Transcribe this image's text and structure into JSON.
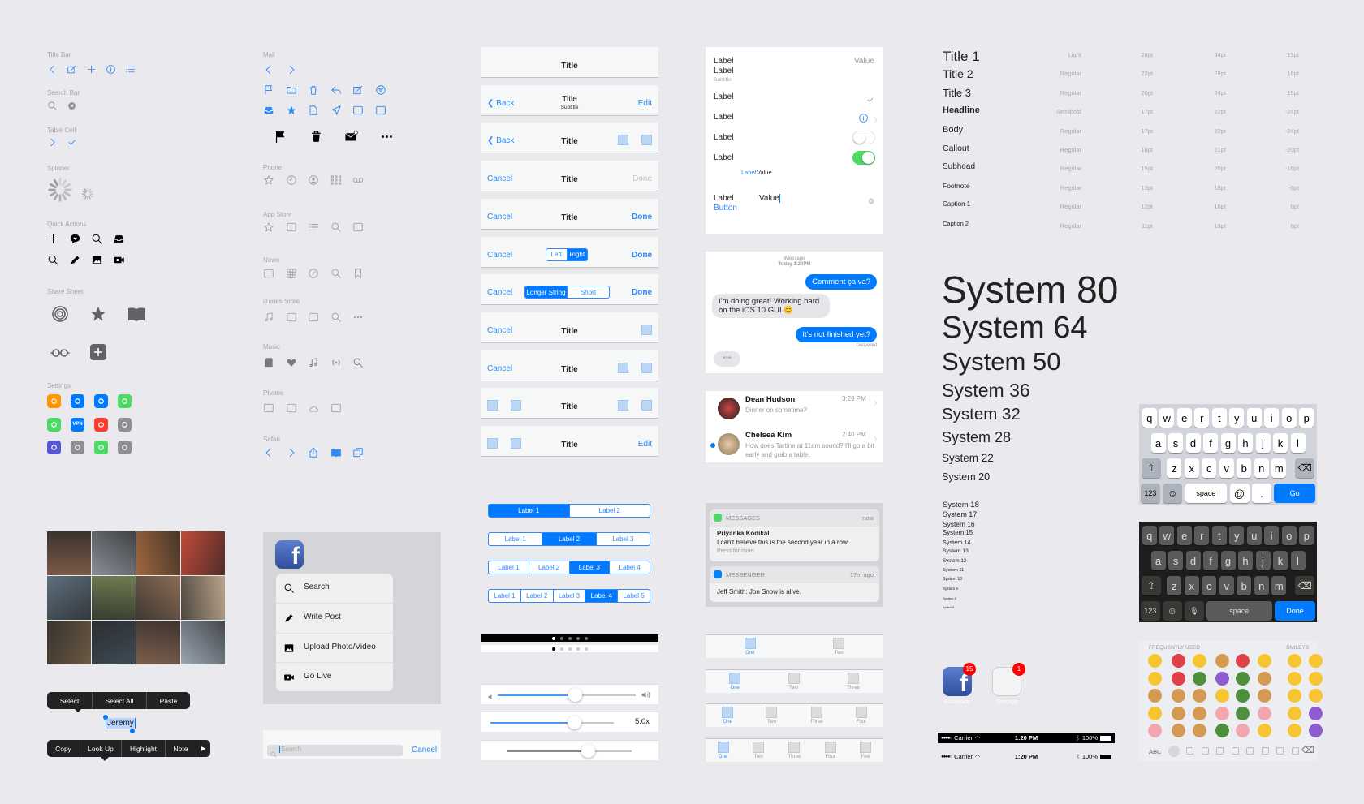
{
  "colors": {
    "accent": "#007aff",
    "green": "#4cd964",
    "background": "#e9e9ee",
    "badge": "#ff0000"
  },
  "left_sections": [
    {
      "label": "Title Bar",
      "color": "#2e88f6",
      "rows": [
        [
          "chevron-left-icon",
          "compose-icon",
          "plus-icon",
          "info-icon",
          "list-icon"
        ]
      ]
    },
    {
      "label": "Search Bar",
      "color": "#8e8e93",
      "rows": [
        [
          "search-icon",
          "clear-icon"
        ]
      ]
    },
    {
      "label": "Table Cell",
      "color": "#2e88f6",
      "rows": [
        [
          "chevron-right-icon",
          "checkmark-icon"
        ]
      ]
    },
    {
      "label": "Spinner",
      "color": "#8e8e93",
      "rows": []
    },
    {
      "label": "Quick Actions",
      "color": "#000000",
      "rows": [
        [
          "plus-icon",
          "message-heart-icon",
          "search-icon",
          "inbox-icon"
        ],
        [
          "search-icon",
          "pencil-icon",
          "photo-icon",
          "video-icon"
        ]
      ]
    },
    {
      "label": "Share Sheet",
      "color": "#636366",
      "rows": [
        [
          "airdrop-icon",
          "star-filled-icon",
          "book-icon"
        ],
        [
          "glasses-icon",
          "add-square-icon"
        ]
      ]
    },
    {
      "label": "Settings",
      "color": "",
      "rows": []
    }
  ],
  "settings_icons": [
    [
      {
        "icon": "airplane-icon",
        "color": "#ff9500"
      },
      {
        "icon": "wifi-icon",
        "color": "#007aff"
      },
      {
        "icon": "bluetooth-icon",
        "color": "#007aff"
      },
      {
        "icon": "cellular-icon",
        "color": "#4cd964"
      }
    ],
    [
      {
        "icon": "hotspot-icon",
        "color": "#4cd964"
      },
      {
        "icon": "vpn-icon",
        "color": "#007aff",
        "text": "VPN"
      },
      {
        "icon": "notifications-icon",
        "color": "#ff3b30"
      },
      {
        "icon": "control-center-icon",
        "color": "#8e8e93"
      }
    ],
    [
      {
        "icon": "do-not-disturb-icon",
        "color": "#5856d6"
      },
      {
        "icon": "general-icon",
        "color": "#8e8e93"
      },
      {
        "icon": "battery-icon",
        "color": "#4cd964"
      },
      {
        "icon": "privacy-icon",
        "color": "#8e8e93"
      }
    ]
  ],
  "mid_sections": [
    {
      "label": "Mail",
      "color": "#2e88f6",
      "rows": [
        [
          "chevron-left-icon",
          "chevron-right-icon"
        ],
        [
          "flag-icon",
          "folder-icon",
          "trash-icon",
          "reply-icon",
          "compose-icon",
          "filter-icon"
        ],
        [
          "inbox-icon",
          "star-filled-icon",
          "document-icon",
          "send-icon",
          "archive-x-icon",
          "archive-icon"
        ]
      ],
      "black_row": [
        "flag-filled-icon",
        "trash-filled-icon",
        "mail-unread-icon",
        "more-icon"
      ]
    },
    {
      "label": "Phone",
      "color": "#a0a0a6",
      "rows": [
        [
          "star-icon",
          "clock-icon",
          "contact-icon",
          "keypad-icon",
          "voicemail-icon"
        ]
      ]
    },
    {
      "label": "App Store",
      "color": "#a0a0a6",
      "rows": [
        [
          "star-icon",
          "stack-icon",
          "list-icon",
          "search-icon",
          "download-icon"
        ]
      ]
    },
    {
      "label": "News",
      "color": "#a0a0a6",
      "rows": [
        [
          "newspaper-icon",
          "grid-icon",
          "compass-icon",
          "search-icon",
          "bookmark-icon"
        ]
      ]
    },
    {
      "label": "iTunes Store",
      "color": "#a0a0a6",
      "rows": [
        [
          "music-note-icon",
          "film-icon",
          "tv-icon",
          "search-icon",
          "more-icon"
        ]
      ]
    },
    {
      "label": "Music",
      "color": "#7a7a80",
      "rows": [
        [
          "library-icon",
          "heart-icon",
          "music-note-icon",
          "radio-icon",
          "search-icon"
        ]
      ]
    },
    {
      "label": "Photos",
      "color": "#a0a0a6",
      "rows": [
        [
          "albums-icon",
          "memories-icon",
          "cloud-icon",
          "stack-icon"
        ]
      ]
    },
    {
      "label": "Safari",
      "color": "#2e88f6",
      "rows": [
        [
          "chevron-left-icon",
          "chevron-right-icon",
          "share-icon",
          "book-icon",
          "tabs-icon"
        ]
      ]
    }
  ],
  "edit_menu": {
    "top": [
      "Select",
      "Select All",
      "Paste"
    ],
    "selected_text": "Jeremy",
    "bottom": [
      "Copy",
      "Look Up",
      "Highlight",
      "Note"
    ]
  },
  "quick_action_menu": {
    "app": "facebook-icon",
    "items": [
      {
        "icon": "search-icon",
        "label": "Search"
      },
      {
        "icon": "pencil-icon",
        "label": "Write Post"
      },
      {
        "icon": "photo-icon",
        "label": "Upload Photo/Video"
      },
      {
        "icon": "video-icon",
        "label": "Go Live"
      }
    ]
  },
  "search_bar": {
    "placeholder": "Search",
    "cancel": "Cancel"
  },
  "nav_bars": [
    {
      "left": "",
      "title": "Title",
      "right": ""
    },
    {
      "left": "Back",
      "back": true,
      "title": "Title",
      "subtitle": "Subtitle",
      "right": "Edit"
    },
    {
      "left": "Back",
      "back": true,
      "title": "Title",
      "right_squares": 2
    },
    {
      "left": "Cancel",
      "title": "Title",
      "right": "Done",
      "right_disabled": true
    },
    {
      "left": "Cancel",
      "title": "Title",
      "right": "Done",
      "right_bold": true
    },
    {
      "left": "Cancel",
      "segment": [
        "Left",
        "Right"
      ],
      "segment_selected": 1,
      "right": "Done",
      "right_bold": true
    },
    {
      "left": "Cancel",
      "segment": [
        "Longer String",
        "Short"
      ],
      "segment_selected": 0,
      "right": "Done",
      "right_bold": true
    },
    {
      "left": "Cancel",
      "title": "Title",
      "right_squares": 1
    },
    {
      "left": "Cancel",
      "title": "Title",
      "right_squares": 2
    },
    {
      "left_squares": 2,
      "title": "Title",
      "right_squares": 2
    },
    {
      "left_squares": 2,
      "title": "Title",
      "right": "Edit"
    }
  ],
  "segmented_controls": [
    {
      "labels": [
        "Label 1",
        "Label 2"
      ],
      "selected": 0
    },
    {
      "labels": [
        "Label 1",
        "Label 2",
        "Label 3"
      ],
      "selected": 1
    },
    {
      "labels": [
        "Label 1",
        "Label 2",
        "Label 3",
        "Label 4"
      ],
      "selected": 2
    },
    {
      "labels": [
        "Label 1",
        "Label 2",
        "Label 3",
        "Label 4",
        "Label 5"
      ],
      "selected": 3
    }
  ],
  "page_controls": {
    "count": 5,
    "current": 0
  },
  "sliders": [
    {
      "value": 0.56,
      "min_icon": "volume-low-icon",
      "max_icon": "volume-high-icon"
    },
    {
      "value": 0.68,
      "label": "5.0x"
    },
    {
      "value": 0.65
    }
  ],
  "table": {
    "rows": [
      {
        "label": "Label",
        "value": "Value"
      },
      {
        "label": "Label",
        "subtitle": "Subtitle"
      },
      {
        "label": "Label",
        "accessory": "checkmark"
      },
      {
        "label": "Label",
        "accessory": "info-disclosure"
      },
      {
        "label": "Label",
        "toggle": false
      },
      {
        "label": "Label",
        "toggle": true
      },
      {
        "inline_label": "Label",
        "inline_value": "Value"
      },
      {
        "label": "Label",
        "field_value": "Value"
      }
    ],
    "button": "Button"
  },
  "imessage": {
    "service": "iMessage",
    "time": "Today 1:20PM",
    "messages": [
      {
        "from": "me",
        "text": "Comment ça va?"
      },
      {
        "from": "them",
        "text": "I'm doing great! Working hard on the iOS 10 GUI 😊"
      },
      {
        "from": "me",
        "text": "It's not finished yet?"
      }
    ],
    "status": "Delivered"
  },
  "conversations": [
    {
      "name": "Dean Hudson",
      "time": "3:29 PM",
      "preview": "Dinner on sometime?",
      "unread": false
    },
    {
      "name": "Chelsea Kim",
      "time": "2:40 PM",
      "preview": "How does Tartine at 11am sound? I'll go a bit early and grab a table.",
      "unread": true
    }
  ],
  "notifications": [
    {
      "app": "MESSAGES",
      "time": "now",
      "title": "Priyanka Kodikal",
      "body": "I can't believe this is the second year in a row.",
      "hint": "Press for more",
      "color": "#4cd964"
    },
    {
      "app": "MESSENGER",
      "time": "17m ago",
      "body": "Jeff Smith: Jon Snow is alive.",
      "color": "#0084ff"
    }
  ],
  "tab_bars": [
    [
      "One",
      "Two"
    ],
    [
      "One",
      "Two",
      "Three"
    ],
    [
      "One",
      "Two",
      "Three",
      "Four"
    ],
    [
      "One",
      "Two",
      "Three",
      "Four",
      "Five"
    ]
  ],
  "typography": [
    {
      "name": "Title 1",
      "weight": "Light",
      "size": "28pt",
      "leading": "34pt",
      "tracking": "13pt"
    },
    {
      "name": "Title 2",
      "weight": "Regular",
      "size": "22pt",
      "leading": "28pt",
      "tracking": "16pt"
    },
    {
      "name": "Title 3",
      "weight": "Regular",
      "size": "20pt",
      "leading": "24pt",
      "tracking": "19pt"
    },
    {
      "name": "Headline",
      "weight": "Semibold",
      "size": "17pt",
      "leading": "22pt",
      "tracking": "-24pt"
    },
    {
      "name": "Body",
      "weight": "Regular",
      "size": "17pt",
      "leading": "22pt",
      "tracking": "-24pt"
    },
    {
      "name": "Callout",
      "weight": "Regular",
      "size": "16pt",
      "leading": "21pt",
      "tracking": "-20pt"
    },
    {
      "name": "Subhead",
      "weight": "Regular",
      "size": "15pt",
      "leading": "20pt",
      "tracking": "-16pt"
    },
    {
      "name": "Footnote",
      "weight": "Regular",
      "size": "13pt",
      "leading": "18pt",
      "tracking": "-6pt"
    },
    {
      "name": "Caption 1",
      "weight": "Regular",
      "size": "12pt",
      "leading": "16pt",
      "tracking": "0pt"
    },
    {
      "name": "Caption 2",
      "weight": "Regular",
      "size": "11pt",
      "leading": "13pt",
      "tracking": "6pt"
    }
  ],
  "system_large": [
    "System 80",
    "System 64",
    "System 50",
    "System 36",
    "System 32",
    "System 28",
    "System 22",
    "System 20"
  ],
  "system_small": [
    "System 18",
    "System 17",
    "System 16",
    "System 15",
    "System 14",
    "System 13",
    "System 12",
    "System 11",
    "System 10",
    "System 9",
    "System 8",
    "System 6"
  ],
  "app_icons": [
    {
      "name": "Facebook",
      "badge": "15"
    },
    {
      "name": "Test App",
      "badge": "1"
    }
  ],
  "status_bar": {
    "carrier": "Carrier",
    "time": "1:20 PM",
    "battery": "100%"
  },
  "keyboard_light": {
    "rows": [
      [
        "q",
        "w",
        "e",
        "r",
        "t",
        "y",
        "u",
        "i",
        "o",
        "p"
      ],
      [
        "a",
        "s",
        "d",
        "f",
        "g",
        "h",
        "j",
        "k",
        "l"
      ],
      [
        "z",
        "x",
        "c",
        "v",
        "b",
        "n",
        "m"
      ]
    ],
    "numbers": "123",
    "space": "space",
    "at": "@",
    "dot": ".",
    "return": "Go"
  },
  "keyboard_dark": {
    "rows": [
      [
        "q",
        "w",
        "e",
        "r",
        "t",
        "y",
        "u",
        "i",
        "o",
        "p"
      ],
      [
        "a",
        "s",
        "d",
        "f",
        "g",
        "h",
        "j",
        "k",
        "l"
      ],
      [
        "z",
        "x",
        "c",
        "v",
        "b",
        "n",
        "m"
      ]
    ],
    "numbers": "123",
    "space": "space",
    "return": "Done"
  },
  "emoji_keyboard": {
    "frequent_header": "FREQUENTLY USED",
    "smileys_header": "SMILEYS",
    "abc": "ABC",
    "frequent": [
      [
        "wink",
        "flag-france",
        "smile",
        "fork-knife",
        "ambulance",
        "heart-eyes"
      ],
      [
        "grin",
        "balloon",
        "tree",
        "devil",
        "cactus",
        "drumstick"
      ],
      [
        "beer",
        "thumbs-up",
        "money",
        "tongue",
        "pine-tree",
        "crown"
      ],
      [
        "persevere",
        "peace",
        "ice-cream",
        "pizza",
        "seedling",
        "pig-nose"
      ],
      [
        "cake",
        "burger",
        "party",
        "palm",
        "pig",
        "astonished"
      ]
    ],
    "smileys": [
      [
        "grinning",
        "sweat-smile"
      ],
      [
        "grimace",
        "laughing"
      ],
      [
        "joy",
        "halo"
      ],
      [
        "smiley",
        "imp"
      ],
      [
        "smile-big",
        "angry-imp"
      ]
    ]
  }
}
